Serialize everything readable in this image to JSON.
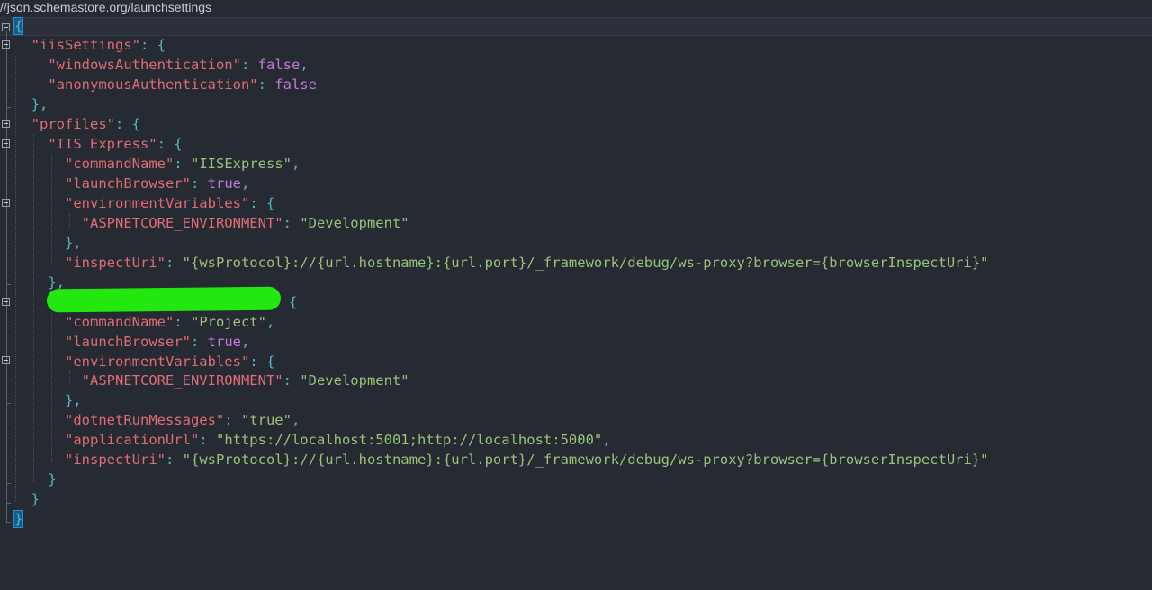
{
  "schema": {
    "url": "//json.schemastore.org/launchsettings"
  },
  "code": {
    "open_root": "{",
    "close_root": "}",
    "iis_settings": {
      "key": "\"iisSettings\"",
      "windows_auth_key": "\"windowsAuthentication\"",
      "windows_auth_value": "false",
      "anonymous_auth_key": "\"anonymousAuthentication\"",
      "anonymous_auth_value": "false"
    },
    "profiles_key": "\"profiles\"",
    "iis_express": {
      "key": "\"IIS Express\"",
      "command_name_key": "\"commandName\"",
      "command_name_value": "\"IISExpress\"",
      "launch_browser_key": "\"launchBrowser\"",
      "launch_browser_value": "true",
      "env_vars_key": "\"environmentVariables\"",
      "env_key": "\"ASPNETCORE_ENVIRONMENT\"",
      "env_value": "\"Development\"",
      "inspect_uri_key": "\"inspectUri\"",
      "inspect_uri_value": "\"{wsProtocol}://{url.hostname}:{url.port}/_framework/debug/ws-proxy?browser={browserInspectUri}\""
    },
    "project": {
      "command_name_key": "\"commandName\"",
      "command_name_value": "\"Project\"",
      "launch_browser_key": "\"launchBrowser\"",
      "launch_browser_value": "true",
      "env_vars_key": "\"environmentVariables\"",
      "env_key": "\"ASPNETCORE_ENVIRONMENT\"",
      "env_value": "\"Development\"",
      "dotnet_run_messages_key": "\"dotnetRunMessages\"",
      "dotnet_run_messages_value": "\"true\"",
      "application_url_key": "\"applicationUrl\"",
      "application_url_value": "\"https://localhost:5001;http://localhost:5000\"",
      "inspect_uri_key": "\"inspectUri\"",
      "inspect_uri_value": "\"{wsProtocol}://{url.hostname}:{url.port}/_framework/debug/ws-proxy?browser={browserInspectUri}\""
    }
  },
  "colors": {
    "background": "#262a33",
    "key": "#e06c75",
    "string": "#98c379",
    "boolean": "#c678dd",
    "punctuation": "#56b6c2",
    "redaction": "#22e80f"
  }
}
